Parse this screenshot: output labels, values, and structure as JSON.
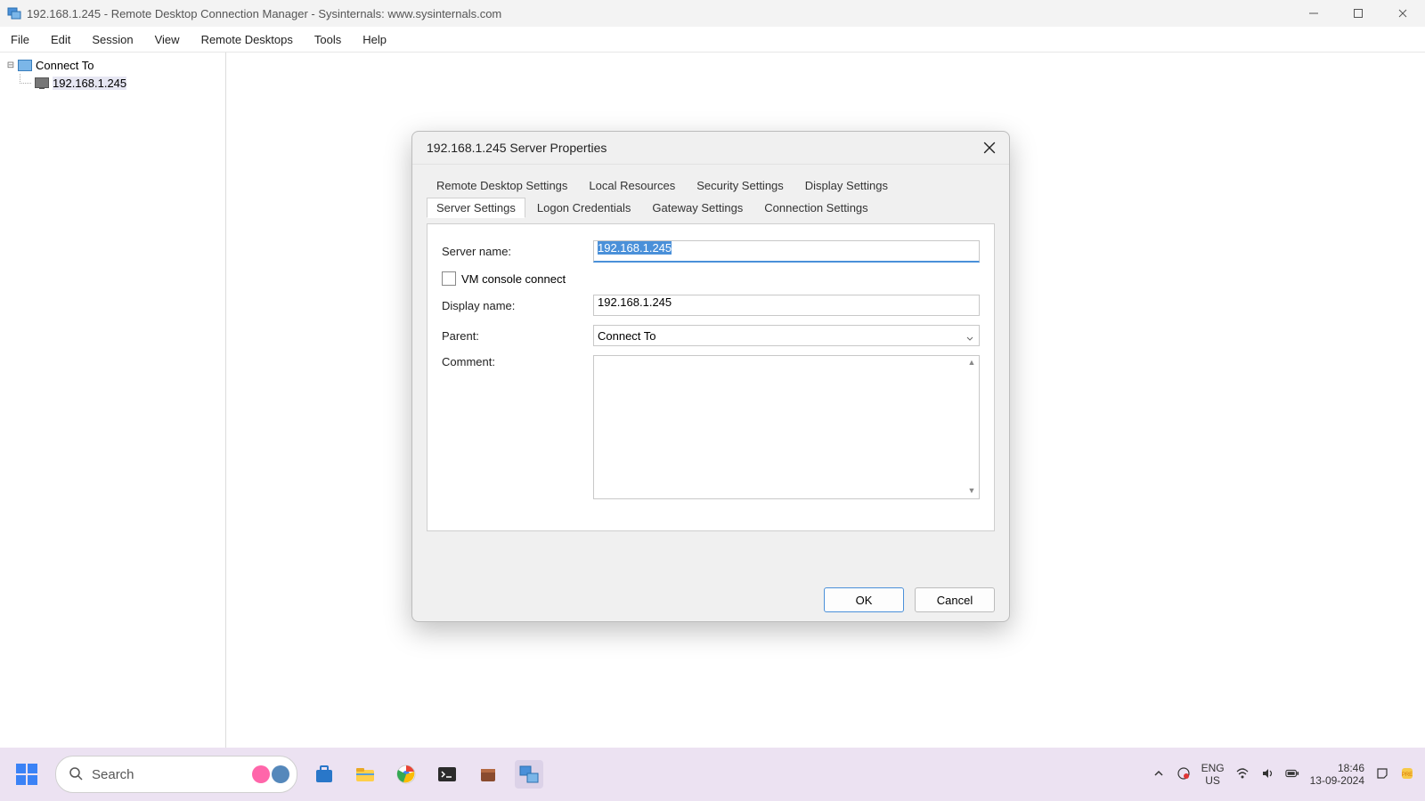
{
  "window": {
    "title": "192.168.1.245 - Remote Desktop Connection Manager - Sysinternals: www.sysinternals.com"
  },
  "menubar": [
    "File",
    "Edit",
    "Session",
    "View",
    "Remote Desktops",
    "Tools",
    "Help"
  ],
  "tree": {
    "root": "Connect To",
    "child": "192.168.1.245"
  },
  "dialog": {
    "title": "192.168.1.245 Server Properties",
    "tabs_row1": [
      "Remote Desktop Settings",
      "Local Resources",
      "Security Settings",
      "Display Settings"
    ],
    "tabs_row2": [
      "Server Settings",
      "Logon Credentials",
      "Gateway Settings",
      "Connection Settings"
    ],
    "active_tab": "Server Settings",
    "labels": {
      "server_name": "Server name:",
      "vm_console": "VM console connect",
      "display_name": "Display name:",
      "parent": "Parent:",
      "comment": "Comment:"
    },
    "values": {
      "server_name": "192.168.1.245",
      "display_name": "192.168.1.245",
      "parent": "Connect To",
      "comment": ""
    },
    "buttons": {
      "ok": "OK",
      "cancel": "Cancel"
    }
  },
  "taskbar": {
    "search_placeholder": "Search",
    "lang_top": "ENG",
    "lang_bottom": "US",
    "time": "18:46",
    "date": "13-09-2024"
  }
}
